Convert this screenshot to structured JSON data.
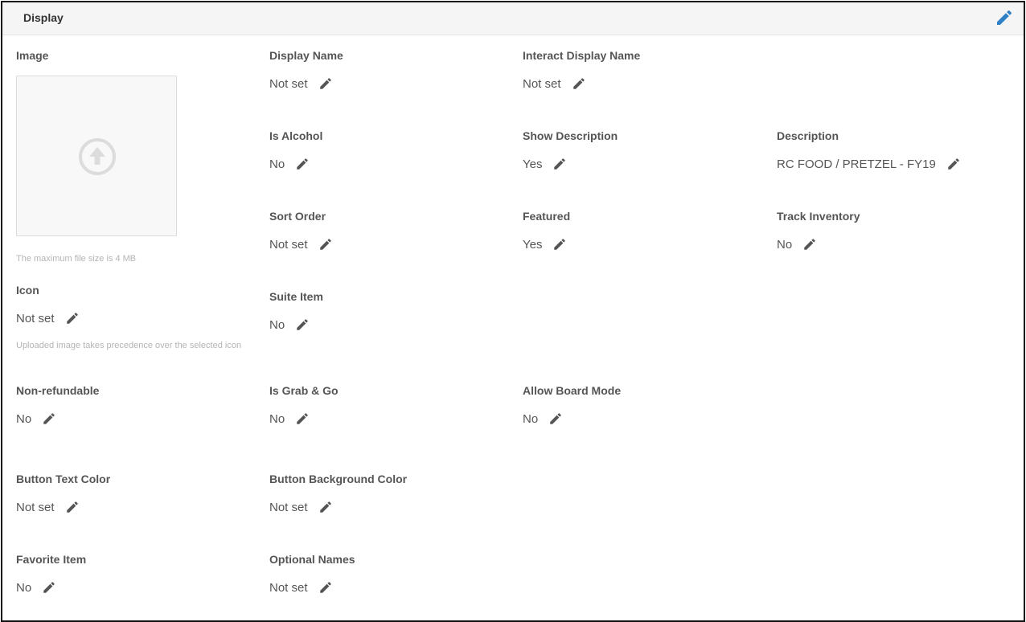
{
  "section": {
    "title": "Display"
  },
  "image": {
    "label": "Image",
    "hint": "The maximum file size is 4 MB"
  },
  "icon": {
    "label": "Icon",
    "value": "Not set",
    "hint": "Uploaded image takes precedence over the selected icon"
  },
  "fields": {
    "display_name": {
      "label": "Display Name",
      "value": "Not set"
    },
    "interact_display_name": {
      "label": "Interact Display Name",
      "value": "Not set"
    },
    "is_alcohol": {
      "label": "Is Alcohol",
      "value": "No"
    },
    "show_description": {
      "label": "Show Description",
      "value": "Yes"
    },
    "description": {
      "label": "Description",
      "value": "RC FOOD / PRETZEL - FY19"
    },
    "sort_order": {
      "label": "Sort Order",
      "value": "Not set"
    },
    "featured": {
      "label": "Featured",
      "value": "Yes"
    },
    "track_inventory": {
      "label": "Track Inventory",
      "value": "No"
    },
    "suite_item": {
      "label": "Suite Item",
      "value": "No"
    },
    "non_refundable": {
      "label": "Non-refundable",
      "value": "No"
    },
    "is_grab_and_go": {
      "label": "Is Grab & Go",
      "value": "No"
    },
    "allow_board_mode": {
      "label": "Allow Board Mode",
      "value": "No"
    },
    "button_text_color": {
      "label": "Button Text Color",
      "value": "Not set"
    },
    "button_background_color": {
      "label": "Button Background Color",
      "value": "Not set"
    },
    "favorite_item": {
      "label": "Favorite Item",
      "value": "No"
    },
    "optional_names": {
      "label": "Optional Names",
      "value": "Not set"
    }
  },
  "colors": {
    "header_bg": "#f5f5f5",
    "header_edit_icon": "#2f80c5",
    "pencil_icon": "#555555",
    "hint_text": "#b4b4b4"
  },
  "icons": {
    "header_edit": "pencil-icon",
    "field_edit": "pencil-icon",
    "upload": "upload-arrow-icon"
  }
}
